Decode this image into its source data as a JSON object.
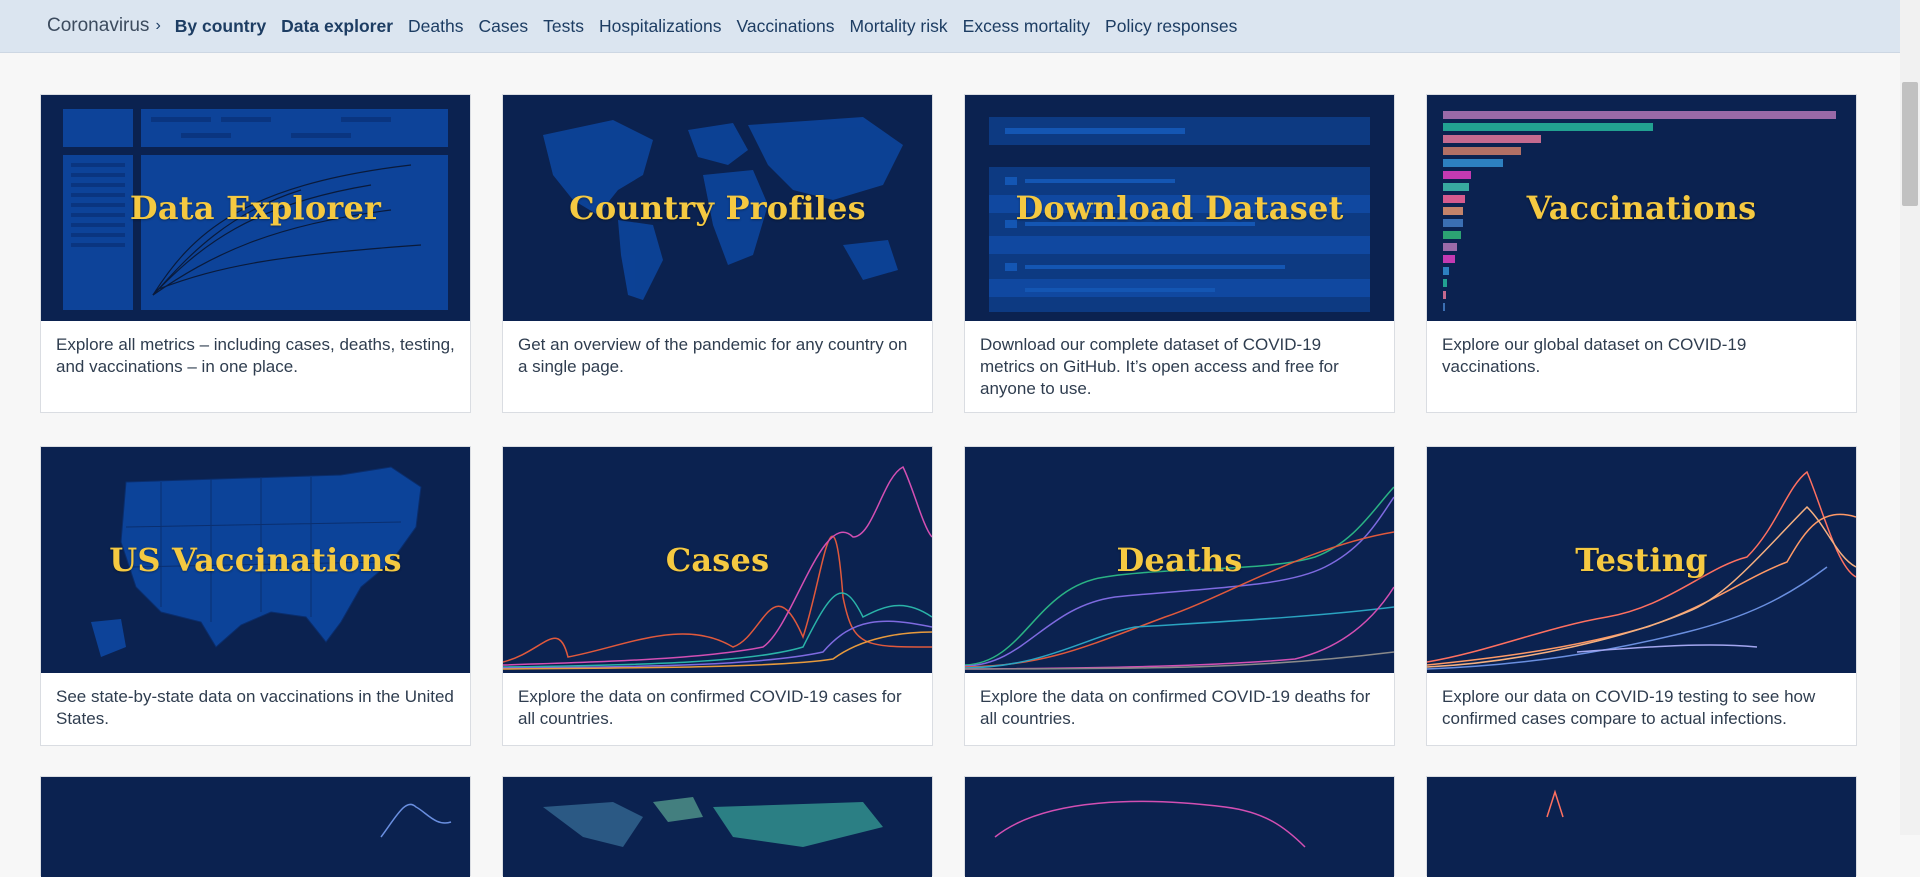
{
  "nav": {
    "crumb": "Coronavirus",
    "links": [
      "By country",
      "Data explorer",
      "Deaths",
      "Cases",
      "Tests",
      "Hospitalizations",
      "Vaccinations",
      "Mortality risk",
      "Excess mortality",
      "Policy responses"
    ]
  },
  "cards": [
    {
      "title": "Data Explorer",
      "desc": "Explore all metrics – including cases, deaths, testing, and vaccinations – in one place."
    },
    {
      "title": "Country Profiles",
      "desc": "Get an overview of the pandemic for any country on a single page."
    },
    {
      "title": "Download Dataset",
      "desc": "Download our complete dataset of COVID-19 metrics on GitHub. It’s open access and free for anyone to use."
    },
    {
      "title": "Vaccinations",
      "desc": "Explore our global dataset on COVID-19 vaccinations."
    },
    {
      "title": "US Vaccinations",
      "desc": "See state-by-state data on vaccinations in the United States."
    },
    {
      "title": "Cases",
      "desc": "Explore the data on confirmed COVID-19 cases for all countries."
    },
    {
      "title": "Deaths",
      "desc": "Explore the data on confirmed COVID-19 deaths for all countries."
    },
    {
      "title": "Testing",
      "desc": "Explore our data on COVID-19 testing to see how confirmed cases compare to actual infections."
    }
  ],
  "colors": {
    "nav_bg": "#dbe5f0",
    "thumb_bg": "#0b2250",
    "title_yellow": "#f5c941"
  }
}
